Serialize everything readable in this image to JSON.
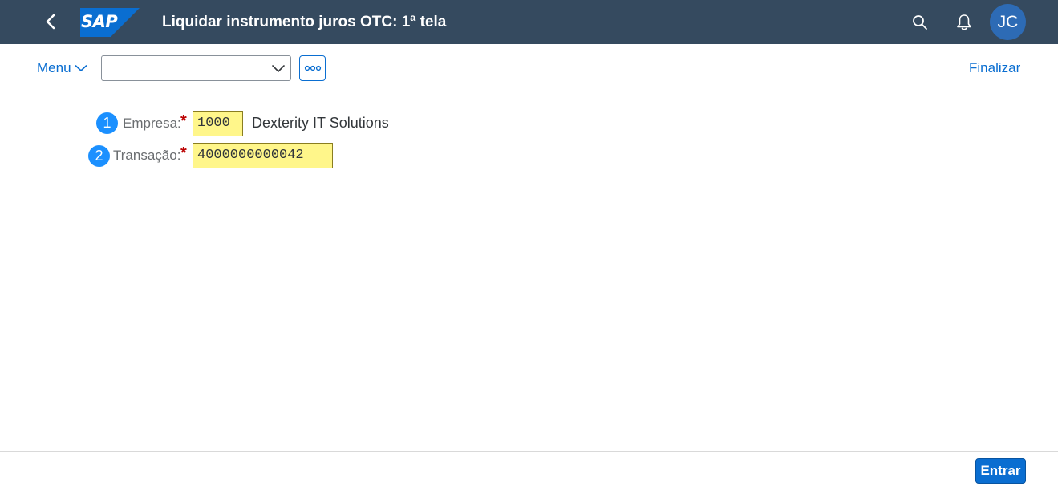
{
  "shell": {
    "title": "Liquidar instrumento juros OTC: 1ª tela",
    "logo_text": "SAP",
    "avatar_initials": "JC",
    "icons": [
      "back-icon",
      "search-icon",
      "bell-icon"
    ],
    "colors": {
      "shellbar": "#354a5f",
      "logo": "#0a6ed1",
      "avatar": "#2d6bb5"
    }
  },
  "toolbar": {
    "menu_label": "Menu",
    "command_value": "",
    "more_icon": "overflow-icon",
    "finalizar_label": "Finalizar"
  },
  "form": {
    "fields": [
      {
        "badge": "1",
        "label": "Empresa:",
        "required_mark": "*",
        "value": "1000",
        "description": "Dexterity IT Solutions"
      },
      {
        "badge": "2",
        "label": "Transação:",
        "required_mark": "*",
        "value": "4000000000042"
      }
    ],
    "colors": {
      "input_bg": "#fff68a",
      "badge": "#1b90ff",
      "required": "#bb0000"
    }
  },
  "footer": {
    "primary_button": "Entrar",
    "colors": {
      "primary": "#0a6ed1"
    }
  }
}
